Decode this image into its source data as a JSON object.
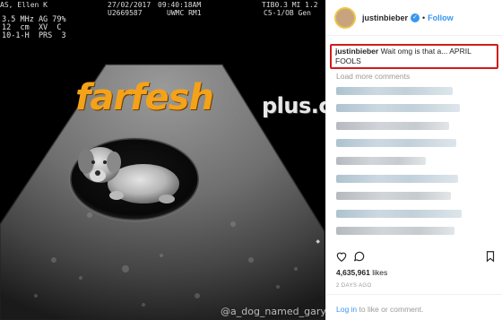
{
  "ultrasound": {
    "header_left": "AS, Ellen K",
    "header_date": "27/02/2017",
    "header_time": "09:40:18AM",
    "header_index": "TIB0.3 MI 1.2",
    "header_id": "U2669587",
    "header_site": "UWMC RM1",
    "header_probe": "C5-1/OB Gen",
    "params_line1": "3.5 MHz AG 79%",
    "params_line2": "12  cm  XV  C",
    "params_line3": "10-1-H  PRS  3",
    "logo_main": "farfesh",
    "logo_plus": "plus.com",
    "watermark": "@a_dog_named_gary"
  },
  "post": {
    "username": "justinbieber",
    "verified_icon": "verified-badge-icon",
    "separator": "•",
    "follow_label": "Follow",
    "highlight_color": "#d01c1c",
    "comment_user": "justinbieber",
    "comment_text": "Wait omg is that a... APRIL FOOLS",
    "load_more": "Load more comments",
    "likes_count": "4,635,961",
    "likes_label": "likes",
    "time_ago": "2 DAYS AGO",
    "login_link": "Log in",
    "login_rest": "to like or comment."
  }
}
